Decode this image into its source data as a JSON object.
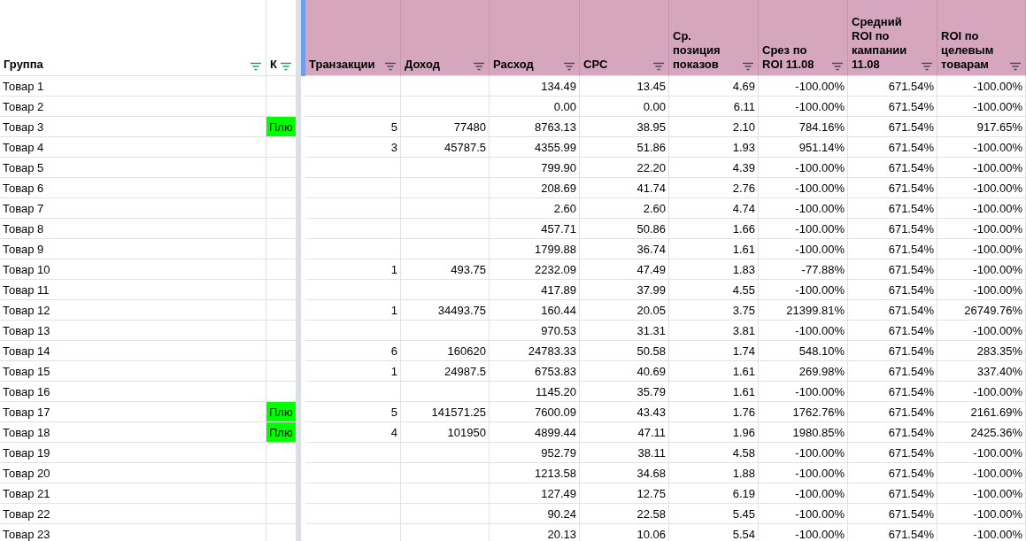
{
  "columns": [
    {
      "label": "Группа",
      "filtered": true,
      "kind": "frozen"
    },
    {
      "label": "К",
      "filtered": true,
      "kind": "frozen"
    },
    {
      "label": "Транзакции",
      "filtered": false,
      "kind": "metric"
    },
    {
      "label": "Доход",
      "filtered": false,
      "kind": "metric"
    },
    {
      "label": "Расход",
      "filtered": false,
      "kind": "metric"
    },
    {
      "label": "CPC",
      "filtered": false,
      "kind": "metric"
    },
    {
      "label": "Ср. позиция показов",
      "filtered": false,
      "kind": "metric"
    },
    {
      "label": "Срез по ROI 11.08",
      "filtered": false,
      "kind": "metric"
    },
    {
      "label": "Средний ROI по кампании 11.08",
      "filtered": false,
      "kind": "metric"
    },
    {
      "label": "ROI по целевым товарам",
      "filtered": false,
      "kind": "metric"
    }
  ],
  "rows": [
    {
      "group": "Товар 1",
      "values": [
        "134.49",
        "13.45",
        "4.69",
        "-100.00%",
        "671.54%",
        "-100.00%"
      ]
    },
    {
      "group": "Товар 2",
      "values": [
        "0.00",
        "0.00",
        "6.11",
        "-100.00%",
        "671.54%",
        "-100.00%"
      ]
    },
    {
      "group": "Товар 3",
      "k": "Плю",
      "transactions": "5",
      "income": "77480",
      "values": [
        "8763.13",
        "38.95",
        "2.10",
        "784.16%",
        "671.54%",
        "917.65%"
      ]
    },
    {
      "group": "Товар 4",
      "transactions": "3",
      "income": "45787.5",
      "values": [
        "4355.99",
        "51.86",
        "1.93",
        "951.14%",
        "671.54%",
        "-100.00%"
      ]
    },
    {
      "group": "Товар 5",
      "values": [
        "799.90",
        "22.20",
        "4.39",
        "-100.00%",
        "671.54%",
        "-100.00%"
      ]
    },
    {
      "group": "Товар 6",
      "values": [
        "208.69",
        "41.74",
        "2.76",
        "-100.00%",
        "671.54%",
        "-100.00%"
      ]
    },
    {
      "group": "Товар 7",
      "values": [
        "2.60",
        "2.60",
        "4.74",
        "-100.00%",
        "671.54%",
        "-100.00%"
      ]
    },
    {
      "group": "Товар 8",
      "values": [
        "457.71",
        "50.86",
        "1.66",
        "-100.00%",
        "671.54%",
        "-100.00%"
      ]
    },
    {
      "group": "Товар 9",
      "values": [
        "1799.88",
        "36.74",
        "1.61",
        "-100.00%",
        "671.54%",
        "-100.00%"
      ]
    },
    {
      "group": "Товар 10",
      "transactions": "1",
      "income": "493.75",
      "values": [
        "2232.09",
        "47.49",
        "1.83",
        "-77.88%",
        "671.54%",
        "-100.00%"
      ]
    },
    {
      "group": "Товар 11",
      "values": [
        "417.89",
        "37.99",
        "4.55",
        "-100.00%",
        "671.54%",
        "-100.00%"
      ]
    },
    {
      "group": "Товар 12",
      "transactions": "1",
      "income": "34493.75",
      "values": [
        "160.44",
        "20.05",
        "3.75",
        "21399.81%",
        "671.54%",
        "26749.76%"
      ]
    },
    {
      "group": "Товар 13",
      "values": [
        "970.53",
        "31.31",
        "3.81",
        "-100.00%",
        "671.54%",
        "-100.00%"
      ]
    },
    {
      "group": "Товар 14",
      "transactions": "6",
      "income": "160620",
      "values": [
        "24783.33",
        "50.58",
        "1.74",
        "548.10%",
        "671.54%",
        "283.35%"
      ]
    },
    {
      "group": "Товар 15",
      "transactions": "1",
      "income": "24987.5",
      "values": [
        "6753.83",
        "40.69",
        "1.61",
        "269.98%",
        "671.54%",
        "337.40%"
      ]
    },
    {
      "group": "Товар 16",
      "values": [
        "1145.20",
        "35.79",
        "1.61",
        "-100.00%",
        "671.54%",
        "-100.00%"
      ]
    },
    {
      "group": "Товар 17",
      "k": "Плю",
      "transactions": "5",
      "income": "141571.25",
      "values": [
        "7600.09",
        "43.43",
        "1.76",
        "1762.76%",
        "671.54%",
        "2161.69%"
      ]
    },
    {
      "group": "Товар 18",
      "k": "Плю",
      "transactions": "4",
      "income": "101950",
      "values": [
        "4899.44",
        "47.11",
        "1.96",
        "1980.85%",
        "671.54%",
        "2425.36%"
      ]
    },
    {
      "group": "Товар 19",
      "values": [
        "952.79",
        "38.11",
        "4.58",
        "-100.00%",
        "671.54%",
        "-100.00%"
      ]
    },
    {
      "group": "Товар 20",
      "values": [
        "1213.58",
        "34.68",
        "1.88",
        "-100.00%",
        "671.54%",
        "-100.00%"
      ]
    },
    {
      "group": "Товар 21",
      "values": [
        "127.49",
        "12.75",
        "6.19",
        "-100.00%",
        "671.54%",
        "-100.00%"
      ]
    },
    {
      "group": "Товар 22",
      "values": [
        "90.24",
        "22.58",
        "5.45",
        "-100.00%",
        "671.54%",
        "-100.00%"
      ]
    },
    {
      "group": "Товар 23",
      "values": [
        "20.13",
        "10.06",
        "5.54",
        "-100.00%",
        "671.54%",
        "-100.00%"
      ]
    }
  ]
}
